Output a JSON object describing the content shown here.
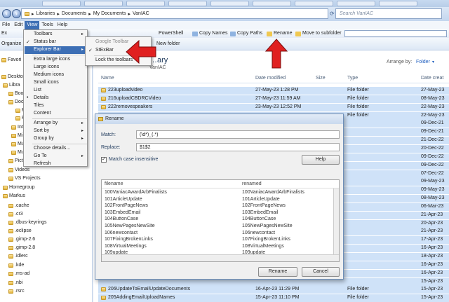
{
  "breadcrumb": {
    "items": [
      "Libraries",
      "Documents",
      "My Documents",
      "VanIAC"
    ]
  },
  "search": {
    "placeholder": "Search VanIAC"
  },
  "menubar": {
    "items": [
      "File",
      "Edit",
      "View",
      "Tools",
      "Help"
    ],
    "active": "View"
  },
  "toolbar": {
    "items": [
      "PowerShell",
      "Copy Names",
      "Copy Paths",
      "Rename",
      "Move to subfolder"
    ],
    "organize": "Organize",
    "new_folder": "New folder"
  },
  "library_header": {
    "title": "…ary",
    "subtitle": "VanIAC",
    "arrange_label": "Arrange by:",
    "arrange_value": "Folder"
  },
  "columns": [
    "Name",
    "Date modified",
    "Size",
    "Type",
    "Date creat"
  ],
  "view_menu": {
    "items": [
      {
        "label": "Toolbars",
        "submenu": true,
        "checked": false
      },
      {
        "label": "Status bar",
        "checked": true
      },
      {
        "label": "Explorer Bar",
        "submenu": true,
        "highlight": true
      },
      {
        "label": "Extra large icons"
      },
      {
        "label": "Large icons"
      },
      {
        "label": "Medium icons"
      },
      {
        "label": "Small icons"
      },
      {
        "label": "List"
      },
      {
        "label": "Details",
        "bullet": true
      },
      {
        "label": "Tiles"
      },
      {
        "label": "Content"
      },
      {
        "label": "Arrange by",
        "submenu": true
      },
      {
        "label": "Sort by",
        "submenu": true
      },
      {
        "label": "Group by",
        "submenu": true
      },
      {
        "label": "Choose details..."
      },
      {
        "label": "Go To",
        "submenu": true
      },
      {
        "label": "Refresh"
      }
    ]
  },
  "submenu": {
    "items": [
      "Google Toolbar",
      "StExBar",
      "Lock the toolbars"
    ],
    "checked": "StExBar"
  },
  "nav": {
    "items": [
      "Favori",
      "Deskto",
      "Libra",
      "Boo",
      "Doc",
      "P",
      "Pi",
      "Inte",
      "Mi",
      "Mu",
      "Mu",
      "Pictures",
      "Videos",
      "VS Projects",
      "Homegroup",
      "Markus",
      ".cache",
      ".cr3",
      ".dbus-keyrings",
      ".eclipse",
      ".gimp-2.6",
      ".gimp-2.8",
      ".idlerc",
      ".kde",
      ".ms-ad",
      ".nbi",
      ".rsrc"
    ]
  },
  "files": [
    {
      "name": "223uploadvideo",
      "date": "27-May-23 1:28 PM",
      "type": "File folder",
      "created": "27-May-23"
    },
    {
      "name": "216uploadCBDRCVideo",
      "date": "27-May-23 11:59 AM",
      "type": "File folder",
      "created": "08-May-23"
    },
    {
      "name": "222removespeakers",
      "date": "23-May-23 12:52 PM",
      "type": "File folder",
      "created": "22-May-23"
    },
    {
      "name": "",
      "date": "",
      "type": "File folder",
      "created": "22-May-23"
    },
    {
      "name": "",
      "date": "",
      "type": "",
      "created": "09-Dec-21"
    },
    {
      "name": "",
      "date": "",
      "type": "",
      "created": "09-Dec-21"
    },
    {
      "name": "",
      "date": "",
      "type": "",
      "created": "21-Dec-22"
    },
    {
      "name": "",
      "date": "",
      "type": "",
      "created": "20-Dec-22"
    },
    {
      "name": "",
      "date": "",
      "type": "",
      "created": "09-Dec-22"
    },
    {
      "name": "",
      "date": "",
      "type": "",
      "created": "09-Dec-22"
    },
    {
      "name": "",
      "date": "",
      "type": "",
      "created": "07-Dec-22"
    },
    {
      "name": "",
      "date": "",
      "type": "",
      "created": "09-May-23"
    },
    {
      "name": "",
      "date": "",
      "type": "",
      "created": "09-May-23"
    },
    {
      "name": "",
      "date": "",
      "type": "",
      "created": "08-May-23"
    },
    {
      "name": "",
      "date": "",
      "type": "",
      "created": "06-Mar-23"
    },
    {
      "name": "",
      "date": "",
      "type": "",
      "created": "21-Apr-23"
    },
    {
      "name": "",
      "date": "",
      "type": "",
      "created": "20-Apr-23"
    },
    {
      "name": "",
      "date": "",
      "type": "",
      "created": "21-Apr-23"
    },
    {
      "name": "",
      "date": "",
      "type": "",
      "created": "17-Apr-23"
    },
    {
      "name": "",
      "date": "",
      "type": "",
      "created": "16-Apr-23"
    },
    {
      "name": "",
      "date": "",
      "type": "",
      "created": "18-Apr-23"
    },
    {
      "name": "",
      "date": "",
      "type": "",
      "created": "16-Apr-23"
    },
    {
      "name": "",
      "date": "",
      "type": "",
      "created": "16-Apr-23"
    },
    {
      "name": "",
      "date": "",
      "type": "",
      "created": "15-Apr-23"
    },
    {
      "name": "206UpdateToEmailUpdateDocuments",
      "date": "16-Apr-23 11:29 PM",
      "type": "File folder",
      "created": "15-Apr-23"
    },
    {
      "name": "205AddingEmailUploadNames",
      "date": "15-Apr-23 11:10 PM",
      "type": "File folder",
      "created": "15-Apr-23"
    }
  ],
  "dialog": {
    "title": "Rename",
    "match_label": "Match:",
    "match_value": "(\\d*)_(.*)",
    "replace_label": "Replace:",
    "replace_value": "$1$2",
    "case_label": "Match case insensitive",
    "case_checked": true,
    "help_label": "Help",
    "grid_headers": [
      "filename",
      "renamed"
    ],
    "grid_rows": [
      [
        "100VaniacAwardArbFinalists",
        "100VaniacAwardArbFinalists"
      ],
      [
        "101ArticleUpdate",
        "101ArticleUpdate"
      ],
      [
        "102FrontPageNews",
        "102FrontPageNews"
      ],
      [
        "103EmbedEmail",
        "103EmbedEmail"
      ],
      [
        "104ButtonCase",
        "104ButtonCase"
      ],
      [
        "105NewPagesNewSite",
        "105NewPagesNewSite"
      ],
      [
        "106newcontact",
        "106newcontact"
      ],
      [
        "107FixingBrokenLinks",
        "107FixingBrokenLinks"
      ],
      [
        "108VirtualMeetings",
        "108VirtualMeetings"
      ],
      [
        "109update",
        "109update"
      ]
    ],
    "rename_label": "Rename",
    "cancel_label": "Cancel"
  },
  "colors": {
    "arrow": "#e02020",
    "selection": "#cfe2f8",
    "menu_highlight": "#3d6fb5"
  }
}
